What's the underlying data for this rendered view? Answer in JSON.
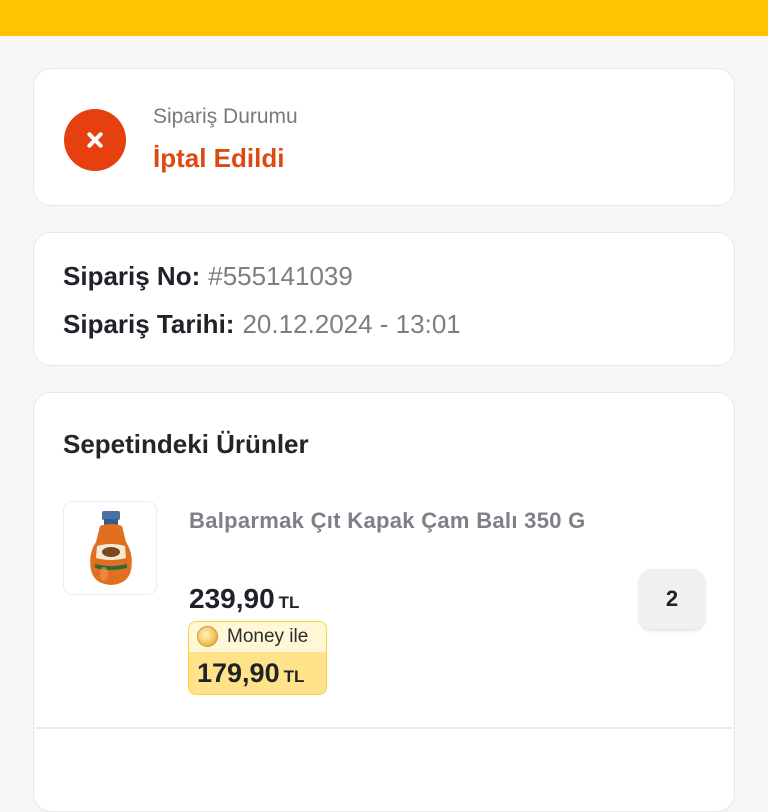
{
  "status": {
    "label": "Sipariş Durumu",
    "value": "İptal Edildi",
    "icon": "close-icon",
    "color": "#e6400f"
  },
  "order": {
    "number_label": "Sipariş No:",
    "number_value": "#555141039",
    "date_label": "Sipariş Tarihi:",
    "date_value": "20.12.2024 - 13:01"
  },
  "products": {
    "title": "Sepetindeki Ürünler",
    "items": [
      {
        "name": "Balparmak Çıt Kapak Çam Balı 350 G",
        "price": "239,90",
        "currency": "TL",
        "money_label": "Money ile",
        "money_price": "179,90",
        "money_currency": "TL",
        "quantity": "2",
        "thumbnail_icon": "honey-bottle-icon"
      }
    ]
  },
  "colors": {
    "accent": "#ffc300",
    "status_red": "#dc4a12",
    "money_bg": "#ffe28a"
  }
}
